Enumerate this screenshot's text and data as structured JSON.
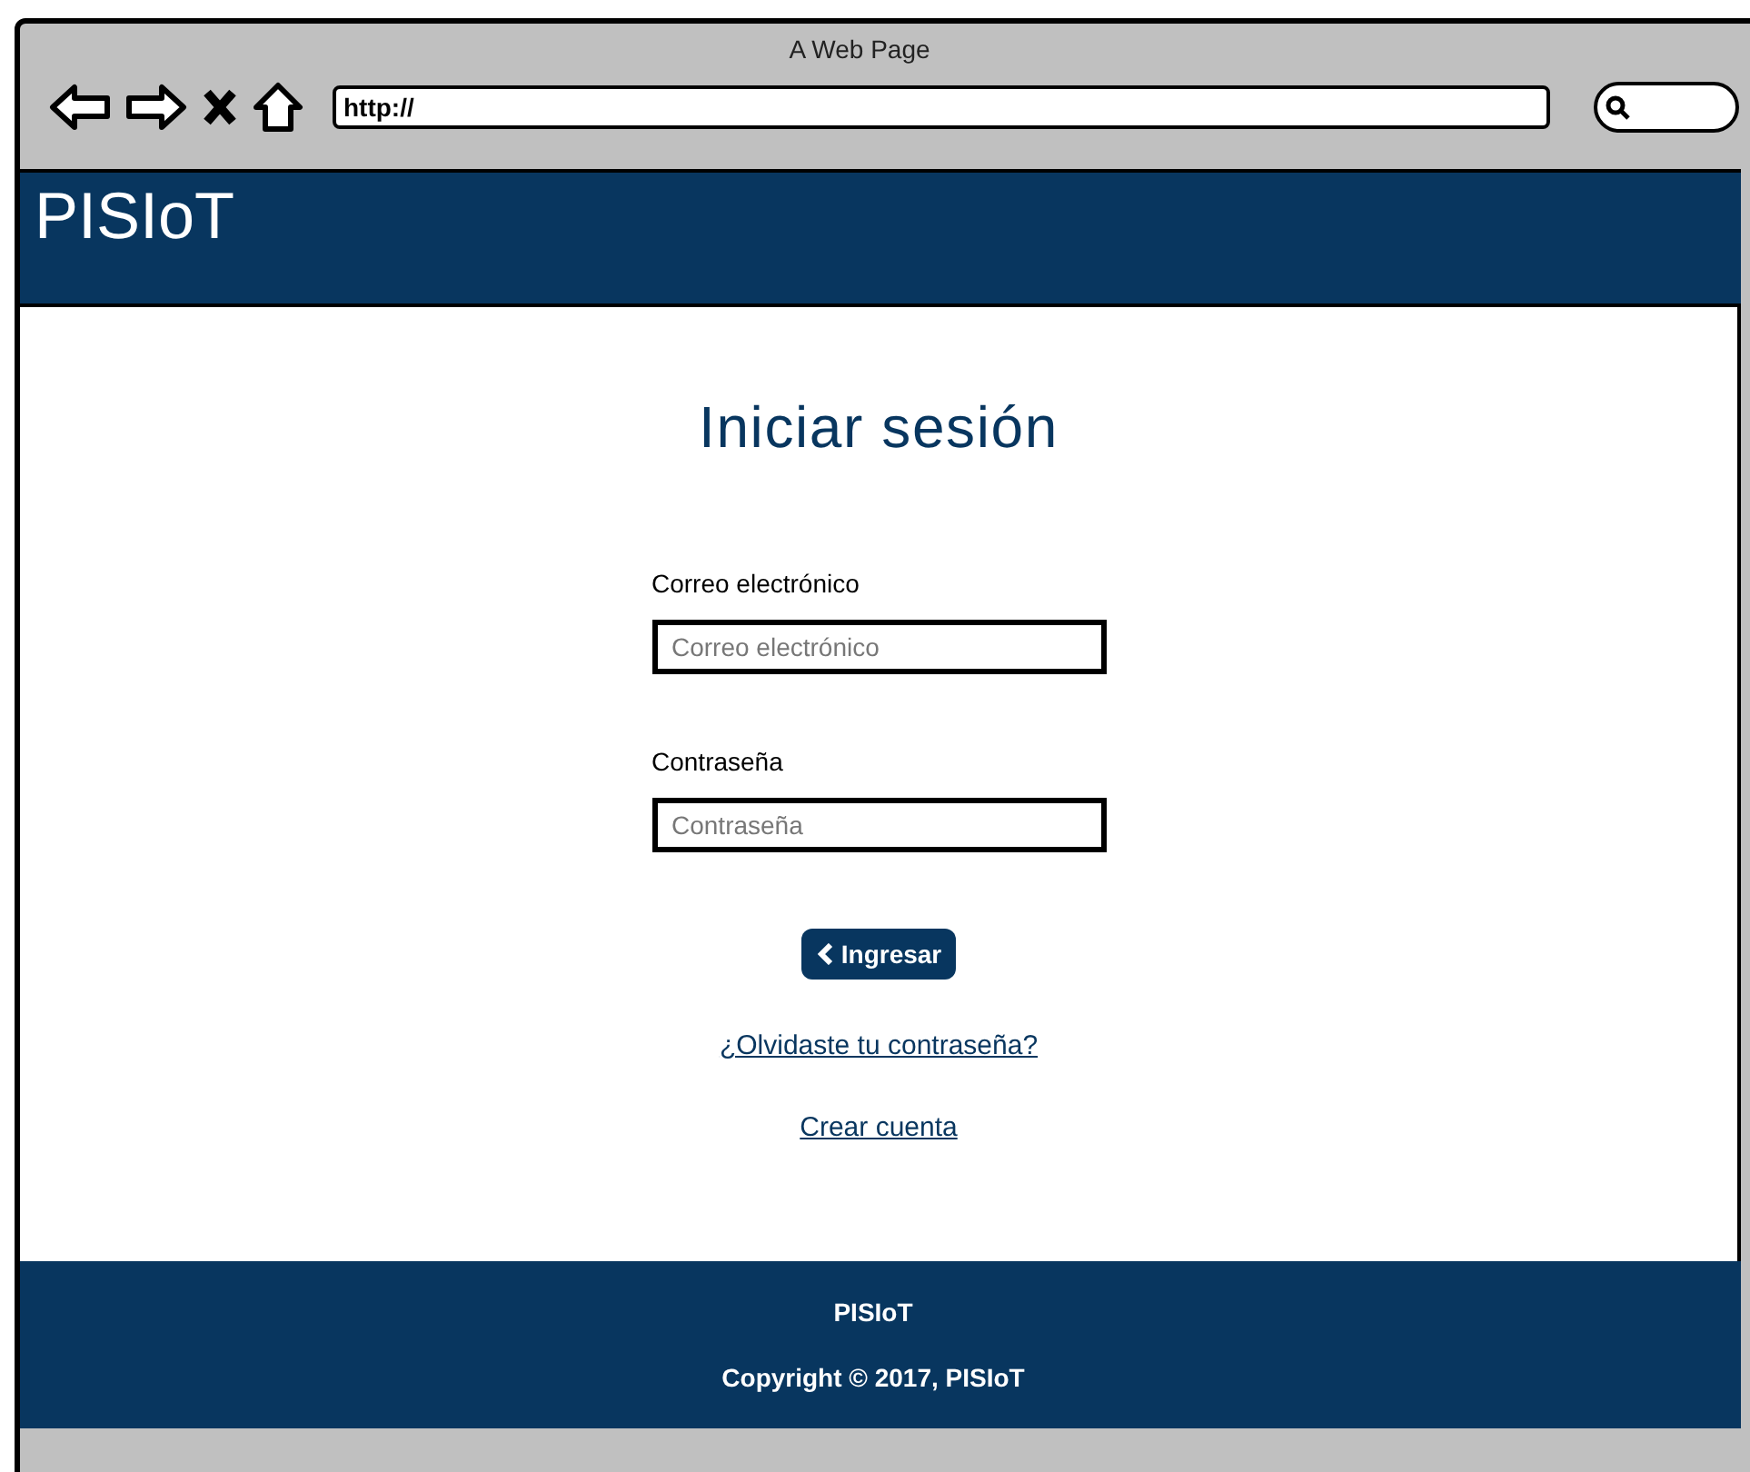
{
  "window": {
    "title": "A Web Page"
  },
  "address_bar": {
    "value": "http://"
  },
  "header": {
    "brand": "PISIoT"
  },
  "login": {
    "title": "Iniciar sesión",
    "fields": [
      {
        "label": "Correo electrónico",
        "placeholder": "Correo electrónico"
      },
      {
        "label": "Contraseña",
        "placeholder": "Contraseña"
      }
    ],
    "submit": "Ingresar",
    "links": [
      "¿Olvidaste tu contraseña?",
      "Crear cuenta"
    ]
  },
  "footer": {
    "brand": "PISIoT",
    "copyright": "Copyright © 2017, PISIoT"
  }
}
